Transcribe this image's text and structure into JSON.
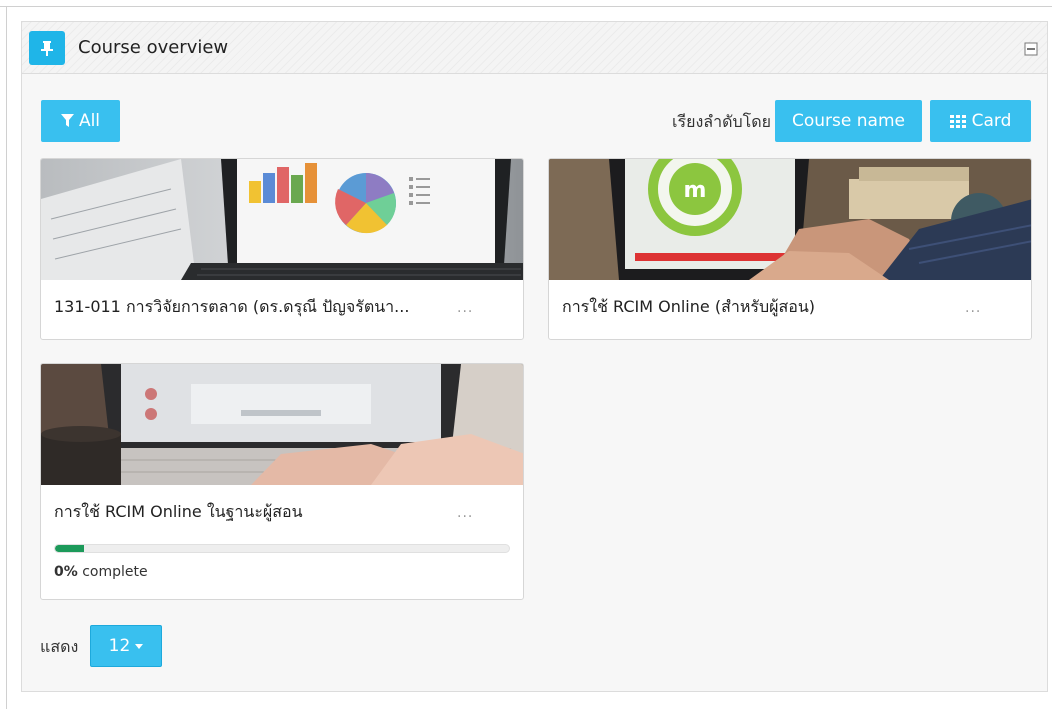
{
  "block": {
    "title": "Course overview",
    "pin_icon": "pin-icon",
    "collapse_icon": "collapse-icon"
  },
  "toolbar": {
    "filter_label": "All",
    "filter_icon": "filter-icon",
    "sort_prefix": "เรียงลำดับโดย",
    "sort_label": "Course name",
    "view_label": "Card",
    "view_icon": "grid-icon"
  },
  "courses": [
    {
      "title": "131-011 การวิจัยการตลาด (ดร.ดรุณี ปัญจรัตนา...",
      "image": "laptop-charts-image",
      "menu": "..."
    },
    {
      "title": "การใช้ RCIM Online (สำหรับผู้สอน)",
      "image": "laptop-moodle-image",
      "menu": "..."
    },
    {
      "title": "การใช้ RCIM Online ในฐานะผู้สอน",
      "image": "laptop-coffee-image",
      "menu": "...",
      "progress_percent": "0%",
      "progress_suffix": " complete"
    }
  ],
  "paging": {
    "show_label": "แสดง",
    "per_page": "12"
  },
  "colors": {
    "accent": "#39c0ef",
    "header_icon_bg": "#1fb5e8",
    "progress": "#1c9a5a"
  }
}
